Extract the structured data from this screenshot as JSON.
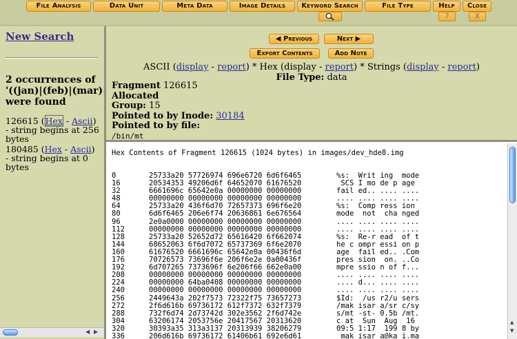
{
  "toolbar": {
    "buttons": [
      "File Analysis",
      "Data Unit",
      "Meta Data",
      "Image Details",
      "Keyword Search",
      "File Type",
      "Help",
      "Close"
    ],
    "help_sub": "?",
    "close_sub": "X"
  },
  "left": {
    "new_search": "New Search",
    "occurrences": [
      "2 occurrences of",
      "'((jan)|(feb)|(mar)|(ap",
      "were found"
    ],
    "results": [
      {
        "fragment": "126615",
        "hex": "Hex",
        "sep": " - ",
        "ascii": "Ascii",
        "note": "- string begins at 256 bytes"
      },
      {
        "fragment": "180485",
        "hex": "Hex",
        "sep": " - ",
        "ascii": "Ascii",
        "note": "- string begins at 0 bytes"
      }
    ]
  },
  "nav": {
    "previous": "Previous",
    "next": "Next",
    "export": "Export Contents",
    "add_note": "Add Note"
  },
  "modes": {
    "ascii": "ASCII",
    "display": "display",
    "report": "report",
    "hex": "Hex",
    "hex_display": "display",
    "strings": "Strings"
  },
  "file_type": {
    "label": "File Type:",
    "value": "data"
  },
  "meta": {
    "fragment_label": "Fragment",
    "fragment": "126615",
    "allocated": "Allocated",
    "group_label": "Group:",
    "group": "15",
    "inode_label": "Pointed to by Inode:",
    "inode": "30184",
    "file_label": "Pointed to by file:",
    "file": "/bin/mt"
  },
  "content": {
    "title": "Hex Contents of Fragment 126615 (1024 bytes) in images/dev_hde8.img",
    "rows": [
      [
        "0",
        "25733a20 57726974 696e6720 6d6f6465",
        "%s:  Writ ing  mode"
      ],
      [
        "16",
        "20534353 49206d6f 64652070 61676520",
        " SCS I mo de p age"
      ],
      [
        "32",
        "6661696c 65642e0a 00000000 00000000",
        "fail ed.. .... ...."
      ],
      [
        "48",
        "00000000 00000000 00000000 00000000",
        ".... .... .... ...."
      ],
      [
        "64",
        "25733a20 436f6d70 72657373 696f6e20",
        "%s:  Comp ress ion"
      ],
      [
        "80",
        "6d6f6465 206e6f74 20636861 6e676564",
        "mode  not  cha nged"
      ],
      [
        "96",
        "2e0a0000 00000000 00000000 00000000",
        ".... .... .... ...."
      ],
      [
        "112",
        "00000000 00000000 00000000 00000000",
        ".... .... .... ...."
      ],
      [
        "128",
        "25733a20 52652d72 65616420 6f662074",
        "%s:  Re-r ead  of t"
      ],
      [
        "144",
        "68652063 6f6d7072 65737369 6f6e2070",
        "he c ompr essi on p"
      ],
      [
        "160",
        "61676520 6661696c 65642e0a 00436f6d",
        "age  fail ed.. .Com"
      ],
      [
        "176",
        "70726573 73696f6e 206f6e2e 0a00436f",
        "pres sion  on. ..Co"
      ],
      [
        "192",
        "6d707265 7373696f 6e206f66 662e0a00",
        "mpre ssio n of f..."
      ],
      [
        "208",
        "00000000 00000000 00000000 00000000",
        ".... .... .... ...."
      ],
      [
        "224",
        "00000000 64ba0408 00000000 00000000",
        ".... d... .... ...."
      ],
      [
        "240",
        "00000000 00000000 00000000 00000000",
        ".... .... .... ...."
      ],
      [
        "256",
        "2449643a 202f7573 72322f75 73657273",
        "$Id:  /us r2/u sers"
      ],
      [
        "272",
        "2f6d616b 69736172 612f7372 632f7379",
        "/mak isar a/sr c/sy"
      ],
      [
        "288",
        "732f6d74 2d73742d 302e3562 2f6d742e",
        "s/mt -st- 0.5b /mt."
      ],
      [
        "304",
        "63206174 2053756e 20417567 20313620",
        "c at  Sun  Aug  16"
      ],
      [
        "320",
        "30393a35 313a3137 20313939 38206279",
        "09:5 1:17  199 8 by"
      ],
      [
        "336",
        "206d616b 69736172 61406b61 692e6d61",
        " mak isar a@ka i.ma"
      ]
    ]
  }
}
